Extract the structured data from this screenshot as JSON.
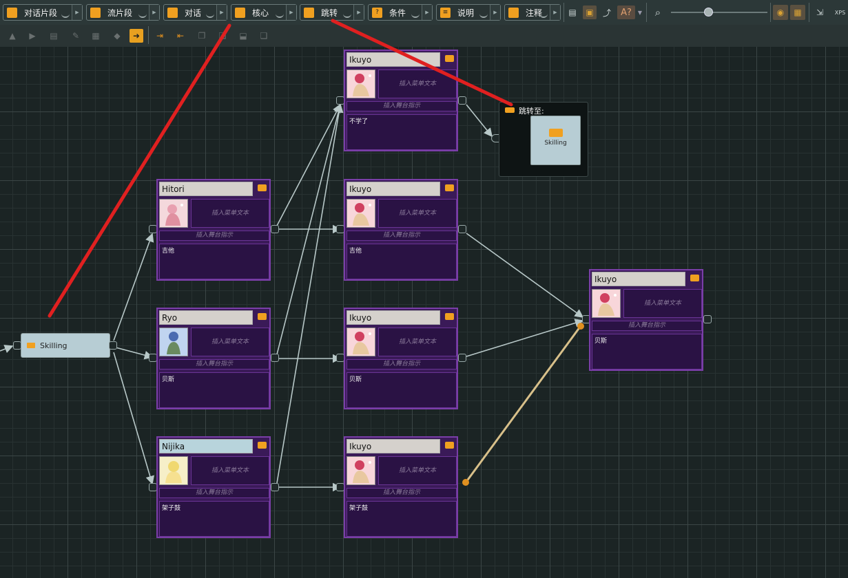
{
  "toolbar": {
    "buttons": [
      {
        "label": "对话片段",
        "icon": "dialogue-fragment-icon"
      },
      {
        "label": "流片段",
        "icon": "flow-fragment-icon"
      },
      {
        "label": "对话",
        "icon": "dialogue-icon"
      },
      {
        "label": "核心",
        "icon": "hub-icon"
      },
      {
        "label": "跳转",
        "icon": "jump-icon"
      },
      {
        "label": "条件",
        "icon": "condition-icon"
      },
      {
        "label": "说明",
        "icon": "instruction-icon"
      },
      {
        "label": "注释",
        "icon": "comment-icon"
      }
    ],
    "right_icons": [
      "list-icon",
      "display-icon",
      "route-icon",
      "localization-icon",
      "zoom-icon",
      "eye-grid-icon",
      "snap-grid-icon",
      "export-icon",
      "xps-icon"
    ],
    "zoom_fraction": 0.39,
    "text_icon_label": "A?",
    "xps_label": "XPS"
  },
  "toolbar2": {
    "icons": [
      "open-icon",
      "play-icon",
      "document-icon",
      "paint-icon",
      "layout-icon",
      "navigate-icon",
      "expand-icon",
      "collapse-icon",
      "copy-icon",
      "paste-icon",
      "move-down-icon",
      "duplicate-icon"
    ]
  },
  "nodes": {
    "start": {
      "label": "Skilling"
    },
    "hitori": {
      "speaker": "Hitori",
      "menu_placeholder": "插入菜单文本",
      "stage_placeholder": "插入舞台指示",
      "text": "吉他"
    },
    "ryo": {
      "speaker": "Ryo",
      "menu_placeholder": "插入菜单文本",
      "stage_placeholder": "插入舞台指示",
      "text": "贝斯"
    },
    "nijika": {
      "speaker": "Nijika",
      "menu_placeholder": "插入菜单文本",
      "stage_placeholder": "插入舞台指示",
      "text": "架子鼓"
    },
    "ikuyo_top": {
      "speaker": "Ikuyo",
      "menu_placeholder": "插入菜单文本",
      "stage_placeholder": "插入舞台指示",
      "text": "不学了"
    },
    "ikuyo_guitar": {
      "speaker": "Ikuyo",
      "menu_placeholder": "插入菜单文本",
      "stage_placeholder": "插入舞台指示",
      "text": "吉他"
    },
    "ikuyo_bass": {
      "speaker": "Ikuyo",
      "menu_placeholder": "插入菜单文本",
      "stage_placeholder": "插入舞台指示",
      "text": "贝斯"
    },
    "ikuyo_drum": {
      "speaker": "Ikuyo",
      "menu_placeholder": "插入菜单文本",
      "stage_placeholder": "插入舞台指示",
      "text": "架子鼓"
    },
    "ikuyo_right": {
      "speaker": "Ikuyo",
      "menu_placeholder": "插入菜单文本",
      "stage_placeholder": "插入舞台指示",
      "text": "贝斯"
    },
    "jump": {
      "title": "跳转至:",
      "target_label": "Skilling"
    }
  },
  "colors": {
    "node_bg": "#3a1a58",
    "node_border": "#7a3ea8",
    "accent_orange": "#f0a020",
    "wire": "#b8c8c8",
    "annotation_red": "#e02020"
  }
}
